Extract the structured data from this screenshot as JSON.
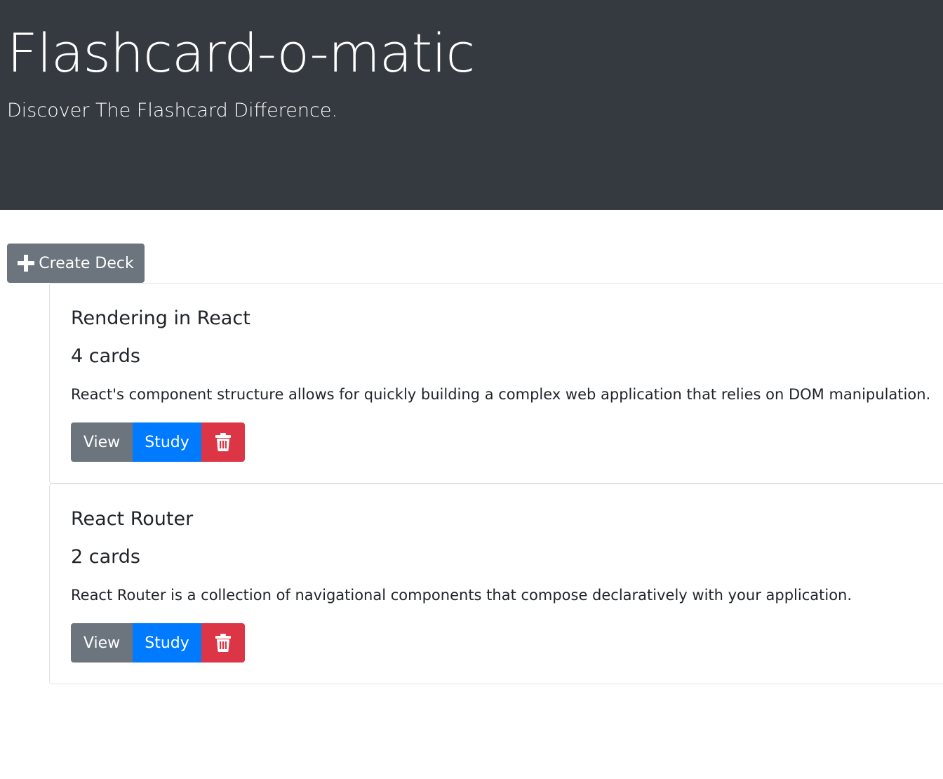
{
  "header": {
    "title": "Flashcard-o-matic",
    "tagline": "Discover The Flashcard Difference."
  },
  "toolbar": {
    "create_deck_label": "Create Deck",
    "create_deck_icon": "plus-icon"
  },
  "decks": [
    {
      "name": "Rendering in React",
      "card_count": "4 cards",
      "description": "React's component structure allows for quickly building a complex web application that relies on DOM manipulation.",
      "view_label": "View",
      "study_label": "Study",
      "delete_icon": "trash-icon"
    },
    {
      "name": "React Router",
      "card_count": "2 cards",
      "description": "React Router is a collection of navigational components that compose declaratively with your application.",
      "view_label": "View",
      "study_label": "Study",
      "delete_icon": "trash-icon"
    }
  ],
  "colors": {
    "header_bg": "#343a40",
    "secondary": "#6c757d",
    "primary": "#007bff",
    "danger": "#dc3545"
  }
}
